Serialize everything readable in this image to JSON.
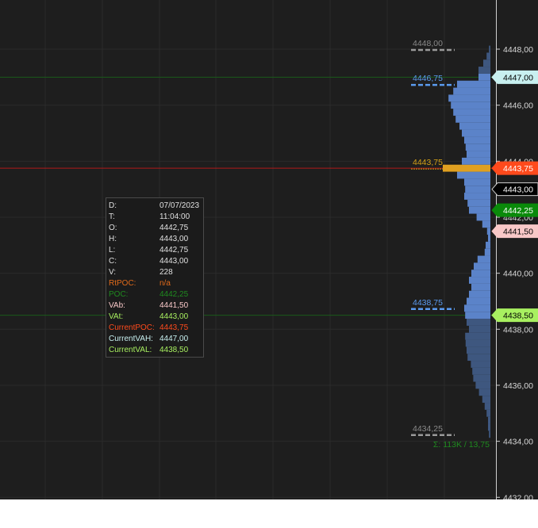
{
  "chart_data": {
    "type": "histogram",
    "orientation": "horizontal",
    "tick_size": 0.25,
    "y_axis": {
      "range": [
        4432.0,
        4448.75
      ],
      "ticks": [
        "4448,00",
        "4446,00",
        "4444,00",
        "4442,00",
        "4440,00",
        "4438,00",
        "4436,00",
        "4434,00",
        "4432,00"
      ],
      "tick_values": [
        4448,
        4446,
        4444,
        4442,
        4440,
        4438,
        4436,
        4434,
        4432
      ]
    },
    "profile": {
      "value_area_high": 4447.0,
      "value_area_low": 4438.5,
      "poc": 4443.75,
      "high": 4448.0,
      "low": 4434.25,
      "levels": [
        {
          "price": 4434.25,
          "volume": 0.03
        },
        {
          "price": 4434.5,
          "volume": 0.05
        },
        {
          "price": 4434.75,
          "volume": 0.05
        },
        {
          "price": 4435.0,
          "volume": 0.08
        },
        {
          "price": 4435.25,
          "volume": 0.12
        },
        {
          "price": 4435.5,
          "volume": 0.17
        },
        {
          "price": 4435.75,
          "volume": 0.24
        },
        {
          "price": 4436.0,
          "volume": 0.31
        },
        {
          "price": 4436.25,
          "volume": 0.36
        },
        {
          "price": 4436.5,
          "volume": 0.38
        },
        {
          "price": 4436.75,
          "volume": 0.41
        },
        {
          "price": 4437.0,
          "volume": 0.48
        },
        {
          "price": 4437.25,
          "volume": 0.5
        },
        {
          "price": 4437.5,
          "volume": 0.52
        },
        {
          "price": 4437.75,
          "volume": 0.53
        },
        {
          "price": 4438.0,
          "volume": 0.45
        },
        {
          "price": 4438.25,
          "volume": 0.5
        },
        {
          "price": 4438.5,
          "volume": 0.53
        },
        {
          "price": 4438.75,
          "volume": 0.55
        },
        {
          "price": 4439.0,
          "volume": 0.5
        },
        {
          "price": 4439.25,
          "volume": 0.45
        },
        {
          "price": 4439.5,
          "volume": 0.4
        },
        {
          "price": 4439.75,
          "volume": 0.45
        },
        {
          "price": 4440.0,
          "volume": 0.4
        },
        {
          "price": 4440.25,
          "volume": 0.35
        },
        {
          "price": 4440.5,
          "volume": 0.27
        },
        {
          "price": 4440.75,
          "volume": 0.12
        },
        {
          "price": 4441.0,
          "volume": 0.1
        },
        {
          "price": 4441.25,
          "volume": 0.05
        },
        {
          "price": 4441.5,
          "volume": 0.07
        },
        {
          "price": 4441.75,
          "volume": 0.17
        },
        {
          "price": 4442.0,
          "volume": 0.29
        },
        {
          "price": 4442.25,
          "volume": 0.45
        },
        {
          "price": 4442.5,
          "volume": 0.48
        },
        {
          "price": 4442.75,
          "volume": 0.55
        },
        {
          "price": 4443.0,
          "volume": 0.53
        },
        {
          "price": 4443.25,
          "volume": 0.55
        },
        {
          "price": 4443.5,
          "volume": 0.7
        },
        {
          "price": 4443.75,
          "volume": 1.0
        },
        {
          "price": 4444.0,
          "volume": 0.6
        },
        {
          "price": 4444.25,
          "volume": 0.5
        },
        {
          "price": 4444.5,
          "volume": 0.52
        },
        {
          "price": 4444.75,
          "volume": 0.55
        },
        {
          "price": 4445.0,
          "volume": 0.6
        },
        {
          "price": 4445.25,
          "volume": 0.65
        },
        {
          "price": 4445.5,
          "volume": 0.73
        },
        {
          "price": 4445.75,
          "volume": 0.78
        },
        {
          "price": 4446.0,
          "volume": 0.83
        },
        {
          "price": 4446.25,
          "volume": 0.88
        },
        {
          "price": 4446.5,
          "volume": 0.78
        },
        {
          "price": 4446.75,
          "volume": 0.7
        },
        {
          "price": 4447.0,
          "volume": 0.25
        },
        {
          "price": 4447.25,
          "volume": 0.25
        },
        {
          "price": 4447.5,
          "volume": 0.15
        },
        {
          "price": 4447.75,
          "volume": 0.08
        },
        {
          "price": 4448.0,
          "volume": 0.03
        }
      ],
      "colors": {
        "value_area": "#5b83c9",
        "outside": "#3e577f",
        "poc": "#e0a020"
      }
    },
    "profile_labels": [
      {
        "text": "4448,00",
        "price": 4448.0,
        "color": "#8a8a8a",
        "line": "#9a9a9a"
      },
      {
        "text": "4446,75",
        "price": 4446.75,
        "color": "#5b9bf0",
        "line": "#5b9bf0"
      },
      {
        "text": "4443,75",
        "price": 4443.75,
        "color": "#d4a017",
        "line": "#d4a017"
      },
      {
        "text": "4438,75",
        "price": 4438.75,
        "color": "#5b9bf0",
        "line": "#5b9bf0"
      },
      {
        "text": "4434,25",
        "price": 4434.25,
        "color": "#8a8a8a",
        "line": "#9a9a9a"
      }
    ],
    "summary_label": {
      "text": "Σ: 113K / 13,75",
      "color": "#1f8a1f"
    },
    "horizontal_lines": [
      {
        "price": 4447.0,
        "color": "#1a5a1a"
      },
      {
        "price": 4443.75,
        "color": "#b01a1a"
      },
      {
        "price": 4438.5,
        "color": "#1a5a1a"
      }
    ],
    "axis_markers": [
      {
        "text": "4447,00",
        "price": 4447.0,
        "bg": "#c8f0f0",
        "fg": "#000000"
      },
      {
        "text": "4443,75",
        "price": 4443.75,
        "bg": "#ff4a1c",
        "fg": "#ffffff"
      },
      {
        "text": "4443,00",
        "price": 4443.0,
        "bg": "#000000",
        "fg": "#ffffff"
      },
      {
        "text": "4442,25",
        "price": 4442.25,
        "bg": "#0a8a0a",
        "fg": "#ffffff"
      },
      {
        "text": "4441,50",
        "price": 4441.5,
        "bg": "#f8c8c8",
        "fg": "#000000"
      },
      {
        "text": "4438,50",
        "price": 4438.5,
        "bg": "#a8f060",
        "fg": "#000000"
      }
    ]
  },
  "tooltip": {
    "rows": [
      {
        "key": "D:",
        "value": "07/07/2023",
        "key_color": "#e0e0e0",
        "value_color": "#e0e0e0"
      },
      {
        "key": "T:",
        "value": "11:04:00",
        "key_color": "#e0e0e0",
        "value_color": "#e0e0e0"
      },
      {
        "key": "O:",
        "value": "4442,75",
        "key_color": "#e0e0e0",
        "value_color": "#e0e0e0"
      },
      {
        "key": "H:",
        "value": "4443,00",
        "key_color": "#e0e0e0",
        "value_color": "#e0e0e0"
      },
      {
        "key": "L:",
        "value": "4442,75",
        "key_color": "#e0e0e0",
        "value_color": "#e0e0e0"
      },
      {
        "key": "C:",
        "value": "4443,00",
        "key_color": "#e0e0e0",
        "value_color": "#e0e0e0"
      },
      {
        "key": "V:",
        "value": "228",
        "key_color": "#e0e0e0",
        "value_color": "#e0e0e0"
      },
      {
        "key": "RtPOC:",
        "value": "n/a",
        "key_color": "#e06a1a",
        "value_color": "#e06a1a"
      },
      {
        "key": "POC:",
        "value": "4442,25",
        "key_color": "#1f8a1f",
        "value_color": "#1f8a1f"
      },
      {
        "key": "VAb:",
        "value": "4441,50",
        "key_color": "#f8c8c8",
        "value_color": "#f8c8c8"
      },
      {
        "key": "VAt:",
        "value": "4443,00",
        "key_color": "#a8f060",
        "value_color": "#a8f060"
      },
      {
        "key": "CurrentPOC:",
        "value": "4443,75",
        "key_color": "#ff4a1c",
        "value_color": "#ff4a1c"
      },
      {
        "key": "CurrentVAH:",
        "value": "4447,00",
        "key_color": "#c8f0f0",
        "value_color": "#c8f0f0"
      },
      {
        "key": "CurrentVAL:",
        "value": "4438,50",
        "key_color": "#a8f060",
        "value_color": "#a8f060"
      }
    ]
  }
}
